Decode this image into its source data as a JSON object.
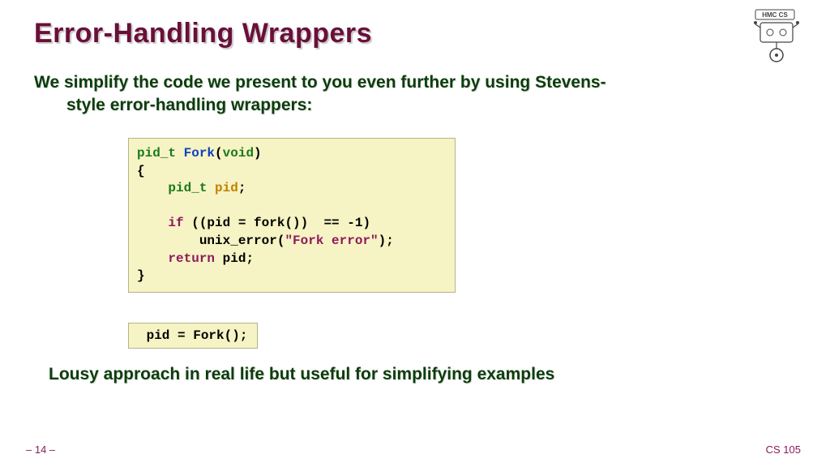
{
  "title": "Error-Handling Wrappers",
  "logo": {
    "label": "HMC CS"
  },
  "intro": {
    "line1": "We simplify the code we present to you even further by using Stevens-",
    "line2": "style error-handling wrappers:"
  },
  "code1": {
    "tokens": {
      "pid_t": "pid_t",
      "Fork": "Fork",
      "void": "void",
      "pid": "pid",
      "if": "if",
      "cond": "((pid = fork())  == -1)",
      "call": "unix_error(",
      "str": "\"Fork error\"",
      "callend": ");",
      "return": "return",
      "semi": ";",
      "lparen": "(",
      "rparen": ")",
      "lbrace": "{",
      "rbrace": "}",
      "sp": " "
    }
  },
  "code2": {
    "text": " pid = Fork();"
  },
  "note": "Lousy approach in real life but useful for simplifying examples",
  "footer": {
    "left": "– 14 –",
    "right": "CS 105"
  }
}
